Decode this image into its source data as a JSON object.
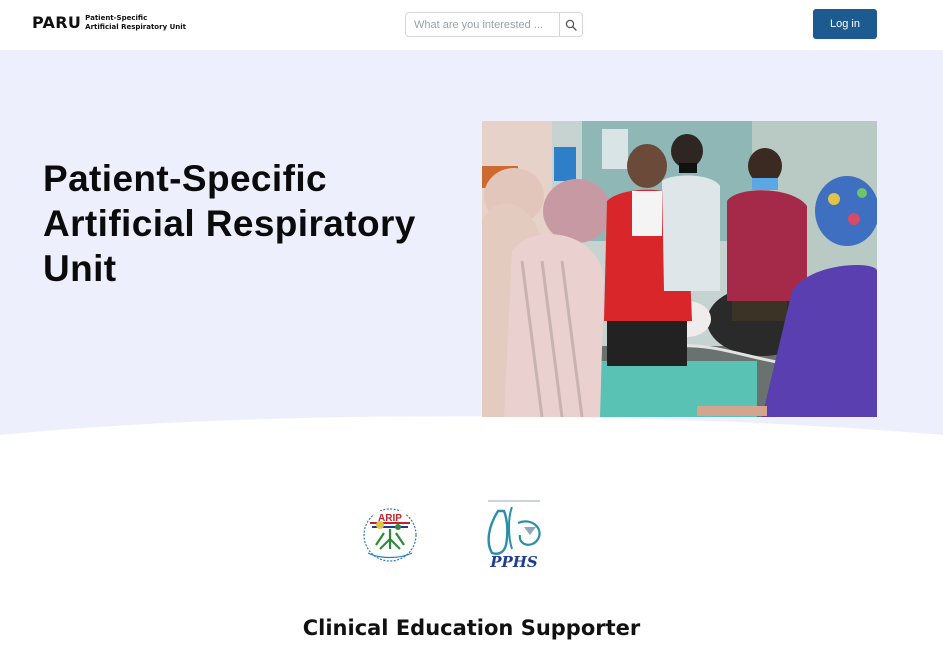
{
  "header": {
    "brand_main": "PARU",
    "brand_sub_line1": "Patient-Specific",
    "brand_sub_line2": "Artificial Respiratory Unit",
    "search_placeholder": "What are you interested ...",
    "search_icon": "search-icon",
    "login_label": "Log in"
  },
  "hero": {
    "title": "Patient-Specific Artificial Respiratory Unit",
    "background": "#edeffc",
    "photo_alt": "Clinicians and staff gathered around a patient simulator with a breathing tube in a training room"
  },
  "partners": {
    "logo_a_text": "ARIP",
    "logo_b_text": "PPHS"
  },
  "section": {
    "title": "Clinical Education Supporter"
  },
  "colors": {
    "accent": "#1c5a8f",
    "hero_bg": "#edeffc"
  }
}
